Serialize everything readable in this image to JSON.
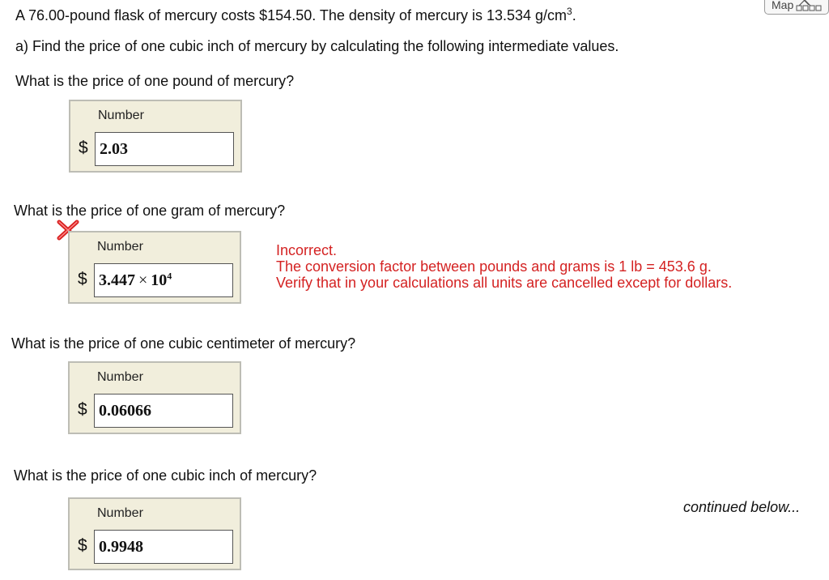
{
  "toolbar": {
    "map_label": "Map"
  },
  "problem": {
    "statement_prefix": "A 76.00-pound flask of mercury costs $154.50.  The density of mercury is 13.534 g/cm",
    "statement_exp": "3",
    "statement_suffix": ".",
    "part_a": "a) Find the price of one cubic inch of mercury by calculating the following intermediate values."
  },
  "questions": [
    {
      "prompt": "What is the price of one pound of mercury?",
      "field_label": "Number",
      "currency": "$",
      "value": "2.03"
    },
    {
      "prompt": "What is the price of one gram of mercury?",
      "field_label": "Number",
      "currency": "$",
      "value_mantissa": "3.447",
      "value_times": "×",
      "value_base": "10",
      "value_exp": "4",
      "status": "incorrect",
      "feedback": {
        "title": "Incorrect.",
        "line1": "The conversion factor between pounds and grams is 1 lb = 453.6 g.",
        "line2": "Verify that in your calculations all units are cancelled except for dollars."
      }
    },
    {
      "prompt": "What is the price of one cubic centimeter of mercury?",
      "field_label": "Number",
      "currency": "$",
      "value": "0.06066"
    },
    {
      "prompt": "What is the price of one cubic inch of mercury?",
      "field_label": "Number",
      "currency": "$",
      "value": "0.9948"
    }
  ],
  "footer": {
    "continued": "continued below..."
  },
  "colors": {
    "error_red": "#d42222",
    "answer_box_bg": "#f1eedc",
    "answer_box_border": "#bdbdb5"
  }
}
